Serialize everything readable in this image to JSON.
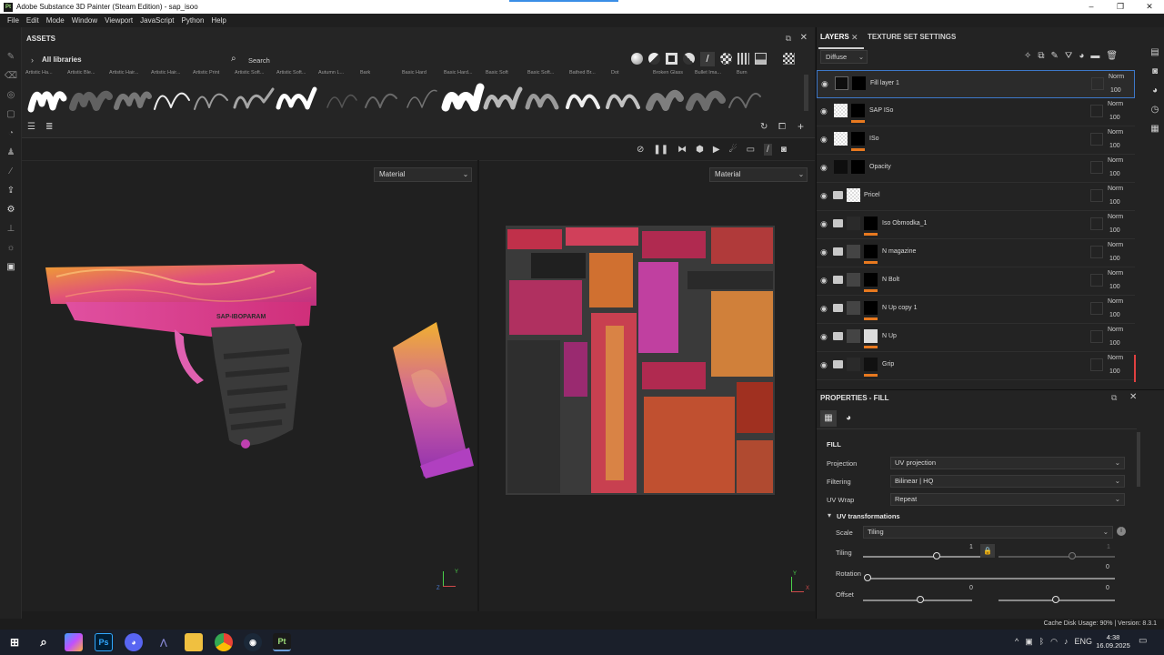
{
  "window": {
    "app_icon": "Pt",
    "title": "Adobe Substance 3D Painter (Steam Edition) - sap_isoo",
    "controls": [
      "–",
      "❐",
      "✕"
    ]
  },
  "menu": [
    "File",
    "Edit",
    "Mode",
    "Window",
    "Viewport",
    "JavaScript",
    "Python",
    "Help"
  ],
  "assets": {
    "title": "ASSETS",
    "library": "All libraries",
    "search_placeholder": "Search",
    "brush_names": [
      "Artistic Ha...",
      "Artistic Ble...",
      "Artistic Hair...",
      "Artistic Hair...",
      "Artistic Print",
      "Artistic Soft...",
      "Artistic Soft...",
      "Autumn L...",
      "Bark",
      "Basic Hard",
      "Basic Hard...",
      "Basic Soft",
      "Basic Soft...",
      "Bathed Br...",
      "Dot",
      "Broken Glass",
      "Bullet Ima...",
      "Burn"
    ]
  },
  "viewport": {
    "left_select": "Material",
    "right_select": "Material",
    "axis_y": "Y",
    "axis_z": "Z",
    "axis_x": "X",
    "gun_text": "SAP-IBOPARAM"
  },
  "layers": {
    "tab_layers": "LAYERS",
    "tab_texture": "TEXTURE SET SETTINGS",
    "channel": "Diffuse",
    "items": [
      {
        "name": "Fill layer 1",
        "blend": "Norm",
        "opacity": "100"
      },
      {
        "name": "SAP ISo",
        "blend": "Norm",
        "opacity": "100"
      },
      {
        "name": "ISo",
        "blend": "Norm",
        "opacity": "100"
      },
      {
        "name": "Opacity",
        "blend": "Norm",
        "opacity": "100"
      },
      {
        "name": "Pricel",
        "blend": "Norm",
        "opacity": "100"
      },
      {
        "name": "Iso Obmodka_1",
        "blend": "Norm",
        "opacity": "100"
      },
      {
        "name": "N magazine",
        "blend": "Norm",
        "opacity": "100"
      },
      {
        "name": "N Bolt",
        "blend": "Norm",
        "opacity": "100"
      },
      {
        "name": "N Up copy 1",
        "blend": "Norm",
        "opacity": "100"
      },
      {
        "name": "N Up",
        "blend": "Norm",
        "opacity": "100"
      },
      {
        "name": "Grip",
        "blend": "Norm",
        "opacity": "100"
      }
    ]
  },
  "properties": {
    "title": "PROPERTIES - FILL",
    "section": "FILL",
    "projection_label": "Projection",
    "projection_value": "UV projection",
    "filtering_label": "Filtering",
    "filtering_value": "Bilinear | HQ",
    "uvwrap_label": "UV Wrap",
    "uvwrap_value": "Repeat",
    "uvt_title": "UV transformations",
    "scale_label": "Scale",
    "scale_value": "Tiling",
    "tiling_label": "Tiling",
    "tiling_value": "1",
    "tiling_value2": "1",
    "rotation_label": "Rotation",
    "rotation_value": "0",
    "offset_label": "Offset",
    "offset_value1": "0",
    "offset_value2": "0"
  },
  "status": {
    "text": "Cache Disk Usage:   90% | Version: 8.3.1"
  },
  "taskbar": {
    "lang": "ENG",
    "time": "4:38",
    "date": "16.09.2025"
  }
}
